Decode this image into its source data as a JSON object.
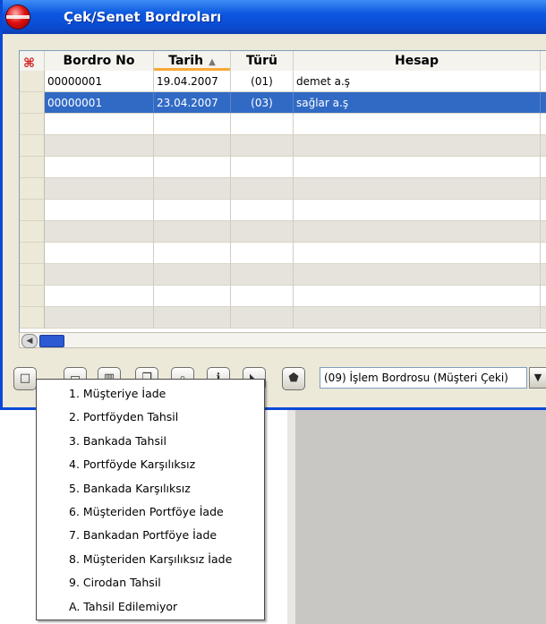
{
  "window": {
    "title": "Çek/Senet Bordroları"
  },
  "grid": {
    "columns": [
      "Bordro No",
      "Tarih",
      "Türü",
      "Hesap"
    ],
    "sort_indicator": "▲",
    "rows": [
      {
        "bordro_no": "00000001",
        "tarih": "19.04.2007",
        "turu": "(01)",
        "hesap": "demet a.ş"
      },
      {
        "bordro_no": "00000001",
        "tarih": "23.04.2007",
        "turu": "(03)",
        "hesap": "sağlar  a.ş"
      }
    ],
    "selected_row": 1,
    "empty_rows": 10
  },
  "toolbar": {
    "buttons": [
      "new-icon",
      "open-icon",
      "trash-icon",
      "copy-icon",
      "search-icon",
      "info-icon",
      "chart-icon",
      "filter-icon"
    ],
    "combo_value": "(09) İşlem Bordrosu (Müşteri Çeki)"
  },
  "menu": {
    "items": [
      "1. Müşteriye İade",
      "2. Portföyden Tahsil",
      "3. Bankada Tahsil",
      "4. Portföyde Karşılıksız",
      "5. Bankada Karşılıksız",
      "6. Müşteriden Portföye İade",
      "7. Bankadan Portföye İade",
      "8. Müşteriden Karşılıksız İade",
      "9. Cirodan Tahsil",
      "A. Tahsil Edilemiyor"
    ]
  },
  "colors": {
    "title_bar": "#0a4bd1",
    "selection": "#316ac5",
    "sort_accent": "#f9a935"
  }
}
